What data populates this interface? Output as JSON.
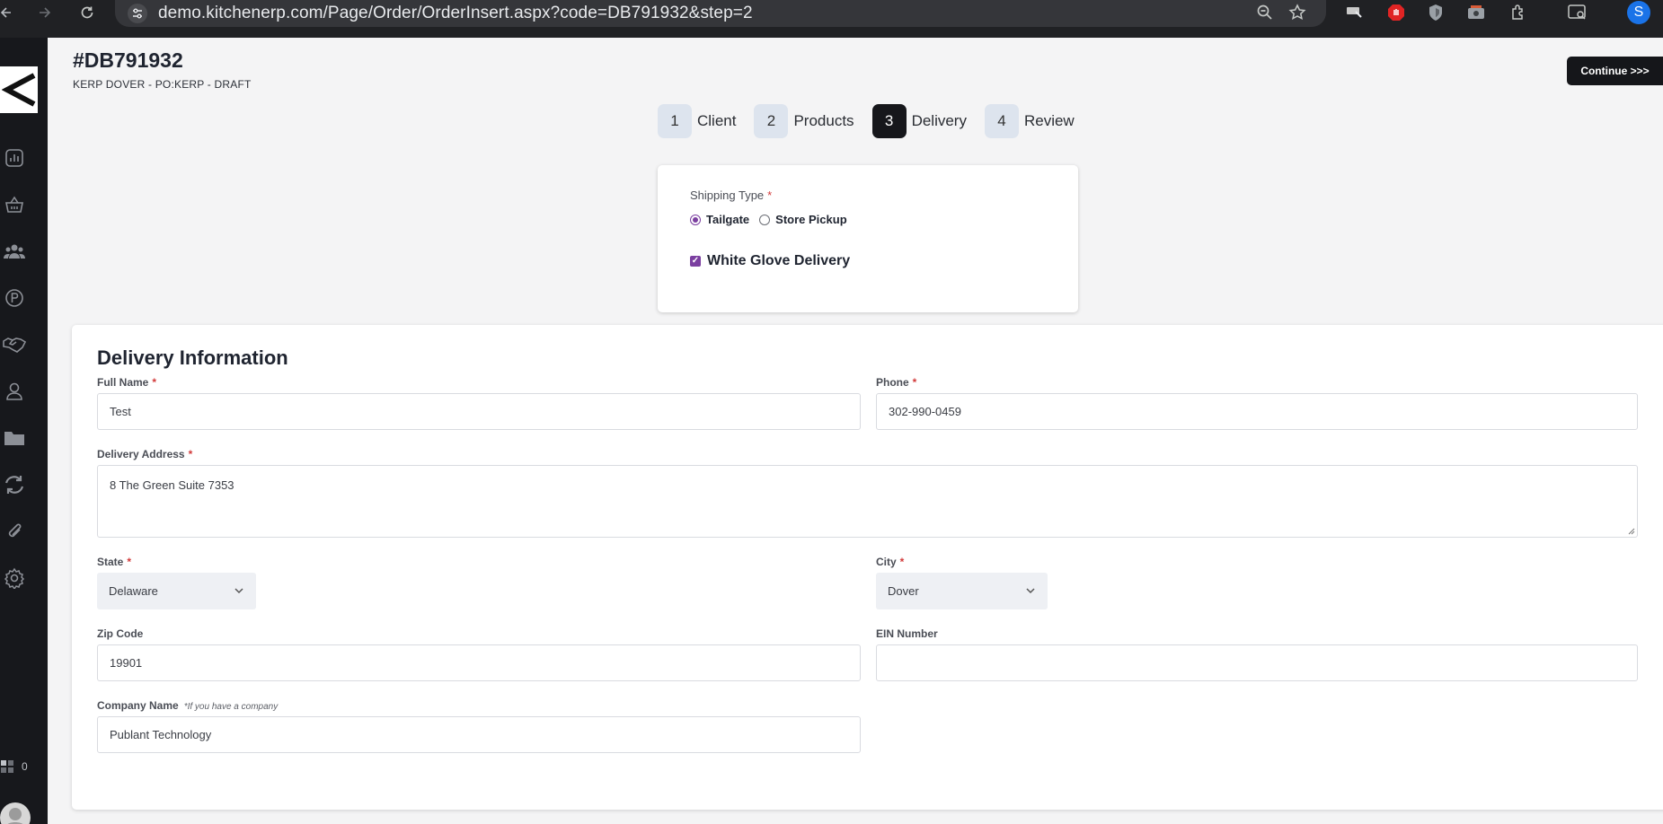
{
  "browser": {
    "url": "demo.kitchenerp.com/Page/Order/OrderInsert.aspx?code=DB791932&step=2",
    "profile_initial": "S"
  },
  "sidebar": {
    "items": [
      {
        "icon": "chart-icon"
      },
      {
        "icon": "basket-icon"
      },
      {
        "icon": "users-icon"
      },
      {
        "icon": "p-circle-icon"
      },
      {
        "icon": "handshake-icon"
      },
      {
        "icon": "person-icon"
      },
      {
        "icon": "folder-icon"
      },
      {
        "icon": "sync-icon"
      },
      {
        "icon": "paperclip-icon"
      },
      {
        "icon": "gear-icon"
      }
    ],
    "counter": "0"
  },
  "header": {
    "order_code": "#DB791932",
    "order_sub": "KERP DOVER - PO:KERP - DRAFT",
    "continue_label": "Continue >>>"
  },
  "steps": [
    {
      "num": "1",
      "label": "Client"
    },
    {
      "num": "2",
      "label": "Products"
    },
    {
      "num": "3",
      "label": "Delivery",
      "active": true
    },
    {
      "num": "4",
      "label": "Review"
    }
  ],
  "shipping": {
    "label": "Shipping Type",
    "required_mark": "*",
    "options": [
      "Tailgate",
      "Store Pickup"
    ],
    "selected": "Tailgate",
    "white_glove_label": "White Glove Delivery",
    "white_glove_checked": true
  },
  "delivery": {
    "title": "Delivery Information",
    "full_name_label": "Full Name",
    "full_name": "Test",
    "phone_label": "Phone",
    "phone": "302-990-0459",
    "address_label": "Delivery Address",
    "address": "8 The Green Suite 7353",
    "state_label": "State",
    "state": "Delaware",
    "city_label": "City",
    "city": "Dover",
    "zip_label": "Zip Code",
    "zip": "19901",
    "ein_label": "EIN Number",
    "ein": "",
    "company_label": "Company Name",
    "company_hint": "*If you have a company",
    "company": "Publant Technology",
    "required_mark": "*"
  },
  "colors": {
    "accent": "#7b3fa0",
    "dark": "#16171b",
    "required": "#d23a3a"
  }
}
